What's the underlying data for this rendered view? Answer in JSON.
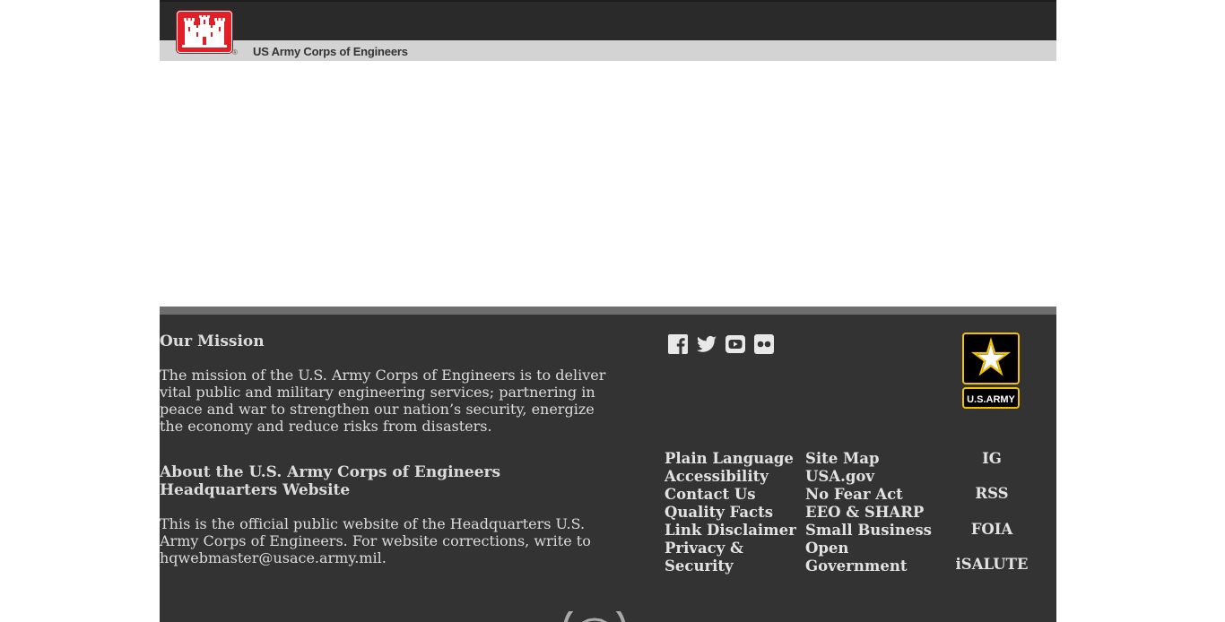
{
  "header": {
    "org_name": "US Army Corps of Engineers",
    "registered_mark": "®",
    "logo_color": "#e21f26",
    "topbar_color": "#2a2a2a",
    "subbar_color": "#d3d3d3"
  },
  "footer": {
    "background_color": "#333333",
    "mission": {
      "title": "Our Mission",
      "text": "The mission of the U.S. Army Corps of Engineers is to deliver vital public and military engineering services; partnering in peace and war to strengthen our nation’s security, energize the economy and reduce risks from disasters."
    },
    "about": {
      "title": "About the U.S. Army Corps of Engineers Headquarters Website",
      "text": "This is the official public website of the Headquarters U.S. Army Corps of Engineers. For website corrections, write to hqwebmaster@usace.army.mil."
    },
    "social_icons": [
      "facebook-icon",
      "twitter-icon",
      "youtube-icon",
      "flickr-icon"
    ],
    "links_col1": [
      "Plain Language",
      "Accessibility",
      "Contact Us",
      "Quality Facts",
      "Link Disclaimer",
      "Privacy & Security"
    ],
    "links_col2": [
      "Site Map",
      "USA.gov",
      "No Fear Act",
      "EEO & SHARP",
      "Small Business Open Government"
    ],
    "links_col3": [
      "IG",
      "RSS",
      "FOIA",
      "iSALUTE"
    ],
    "army_logo_text": "U.S.ARMY",
    "army_logo_color": "#f2c200"
  }
}
